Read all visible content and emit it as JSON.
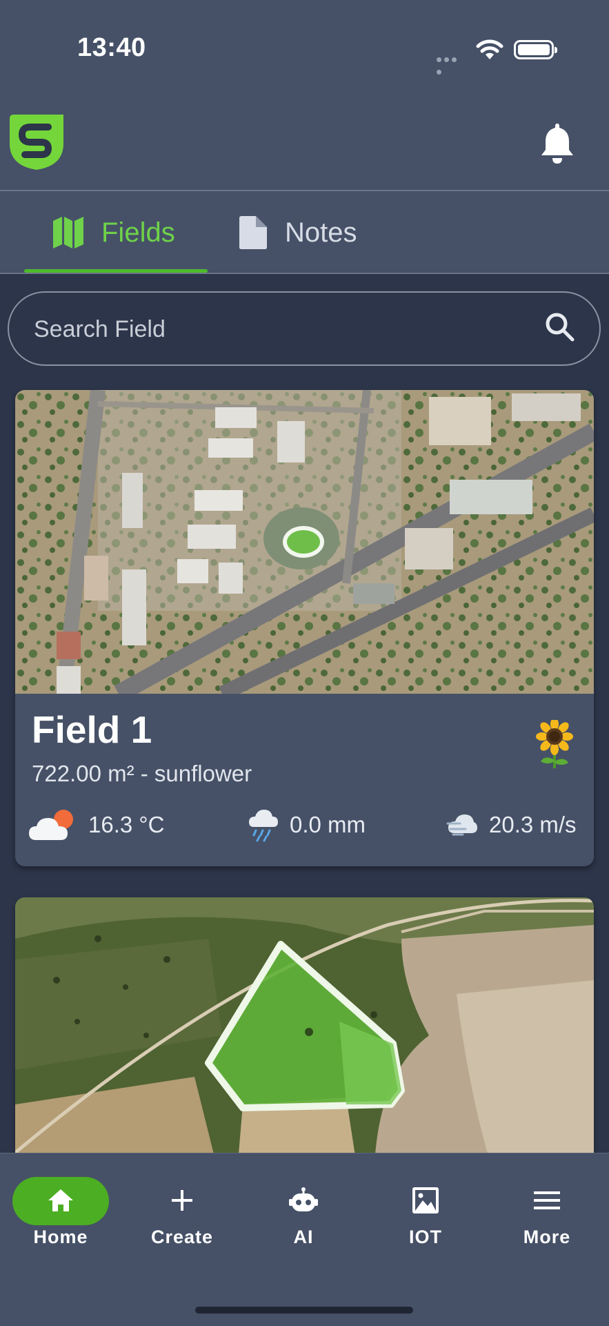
{
  "status_bar": {
    "time": "13:40"
  },
  "header": {
    "logo_icon": "app-logo-s",
    "notification_icon": "bell-icon"
  },
  "tabs": [
    {
      "label": "Fields",
      "icon": "map-icon",
      "active": true
    },
    {
      "label": "Notes",
      "icon": "document-icon",
      "active": false
    }
  ],
  "search": {
    "placeholder": "Search Field",
    "value": ""
  },
  "fields": [
    {
      "name": "Field 1",
      "subtitle": "722.00 m² - sunflower",
      "crop_icon": "sunflower-icon",
      "weather": {
        "temperature": "16.3 °C",
        "precipitation": "0.0 mm",
        "wind": "20.3 m/s"
      }
    },
    {
      "name": "",
      "subtitle": ""
    }
  ],
  "bottom_nav": [
    {
      "label": "Home",
      "icon": "home-icon",
      "active": true
    },
    {
      "label": "Create",
      "icon": "plus-icon",
      "active": false
    },
    {
      "label": "AI",
      "icon": "robot-icon",
      "active": false
    },
    {
      "label": "IOT",
      "icon": "image-icon",
      "active": false
    },
    {
      "label": "More",
      "icon": "menu-icon",
      "active": false
    }
  ],
  "colors": {
    "accent": "#4cae22",
    "accent_text": "#6fd24a",
    "surface": "#465167",
    "background": "#2c3549"
  }
}
